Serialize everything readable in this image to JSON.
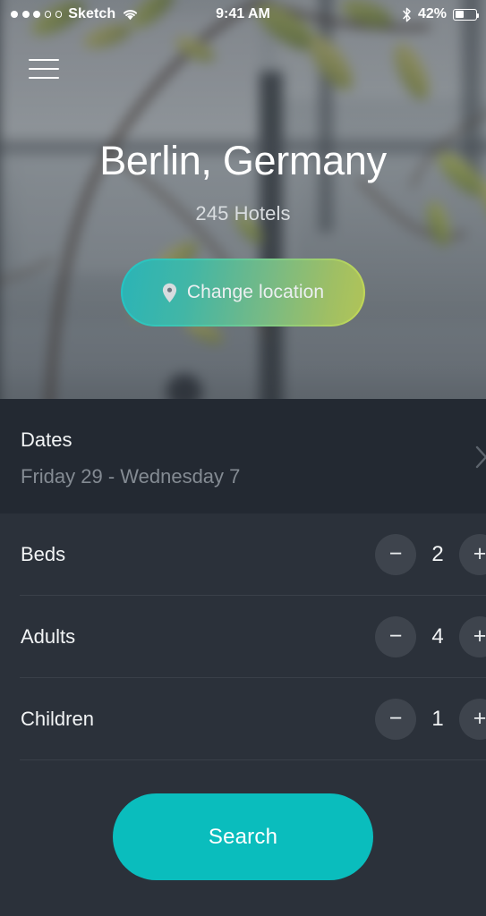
{
  "status_bar": {
    "carrier": "Sketch",
    "signal_dots_filled": 3,
    "signal_dots_total": 5,
    "wifi_icon": "wifi-icon",
    "time": "9:41 AM",
    "bluetooth_icon": "bluetooth-icon",
    "battery_percent": "42%",
    "battery_level": 42
  },
  "hero": {
    "menu_icon": "hamburger-menu-icon",
    "title": "Berlin, Germany",
    "subtitle": "245 Hotels",
    "change_location": {
      "label": "Change location",
      "icon": "map-pin-icon",
      "border_gradient_start": "#22c4c6",
      "border_gradient_end": "#c3d755"
    }
  },
  "search_form": {
    "dates": {
      "label": "Dates",
      "value": "Friday 29 - Wednesday 7",
      "chevron_icon": "chevron-right-icon"
    },
    "counters": [
      {
        "label": "Beds",
        "value": "2",
        "decrement_label": "−",
        "increment_label": "+"
      },
      {
        "label": "Adults",
        "value": "4",
        "decrement_label": "−",
        "increment_label": "+"
      },
      {
        "label": "Children",
        "value": "1",
        "decrement_label": "−",
        "increment_label": "+"
      }
    ],
    "search_label": "Search"
  },
  "colors": {
    "accent_teal": "#0abdbd",
    "panel_background": "#2b313a",
    "dates_background": "#232932",
    "divider": "#3a4049",
    "stepper_circle": "#3e444d",
    "primary_text": "#f2f4f5",
    "secondary_text": "#848b93"
  }
}
